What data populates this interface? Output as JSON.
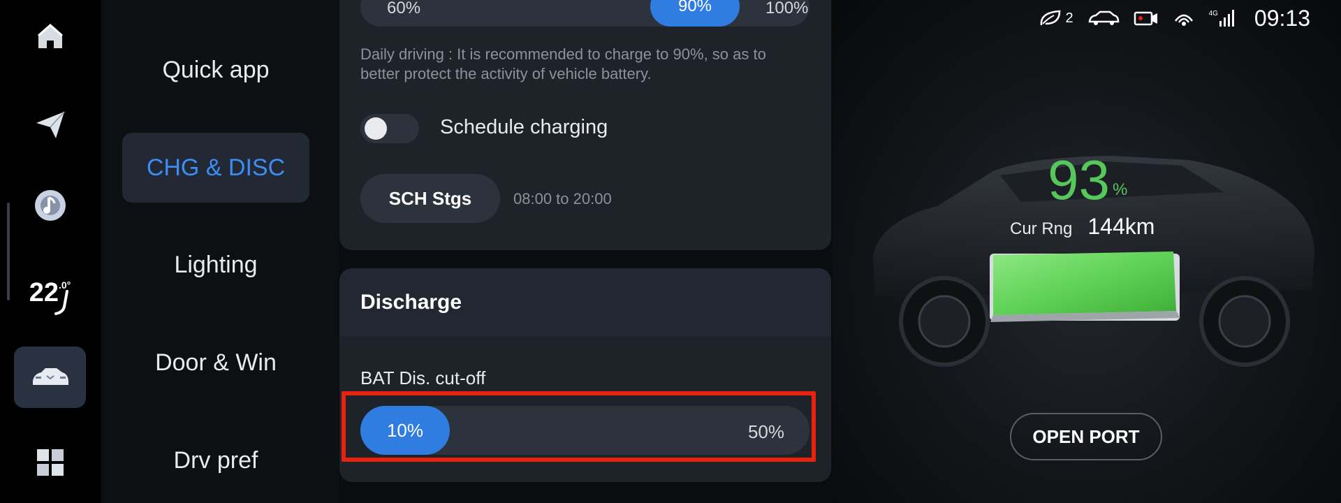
{
  "rail": {
    "items": [
      {
        "icon": "home-icon"
      },
      {
        "icon": "navigation-icon"
      },
      {
        "icon": "music-icon"
      },
      {
        "icon": "climate-temp",
        "temp_value": "22",
        "temp_decimal": ".0°"
      },
      {
        "icon": "car-icon",
        "active": true
      },
      {
        "icon": "apps-grid-icon"
      }
    ]
  },
  "menu": {
    "items": [
      {
        "label": "Quick app"
      },
      {
        "label": "CHG & DISC",
        "active": true
      },
      {
        "label": "Lighting"
      },
      {
        "label": "Door & Win"
      },
      {
        "label": "Drv pref"
      }
    ]
  },
  "charge": {
    "slider": {
      "min_label": "60%",
      "value_label": "90%",
      "max_label": "100%",
      "value": 90
    },
    "hint": "Daily driving : It is recommended to charge to 90%, so as to better protect the activity of vehicle battery.",
    "schedule_label": "Schedule charging",
    "schedule_on": false,
    "sch_button": "SCH Stgs",
    "sch_time": "08:00 to 20:00"
  },
  "discharge": {
    "title": "Discharge",
    "cutoff_label": "BAT Dis. cut-off",
    "slider": {
      "value_label": "10%",
      "max_label": "50%",
      "value": 10
    }
  },
  "status": {
    "eco_count": "2",
    "network": "4G",
    "clock": "09:13"
  },
  "vehicle": {
    "battery_pct": "93",
    "battery_unit": "%",
    "range_label": "Cur Rng",
    "range_value": "144km",
    "open_port": "OPEN PORT"
  },
  "colors": {
    "accent": "#2f7de1",
    "active_text": "#3d8df5",
    "battery_green": "#56c75a",
    "highlight": "#e8220f"
  }
}
